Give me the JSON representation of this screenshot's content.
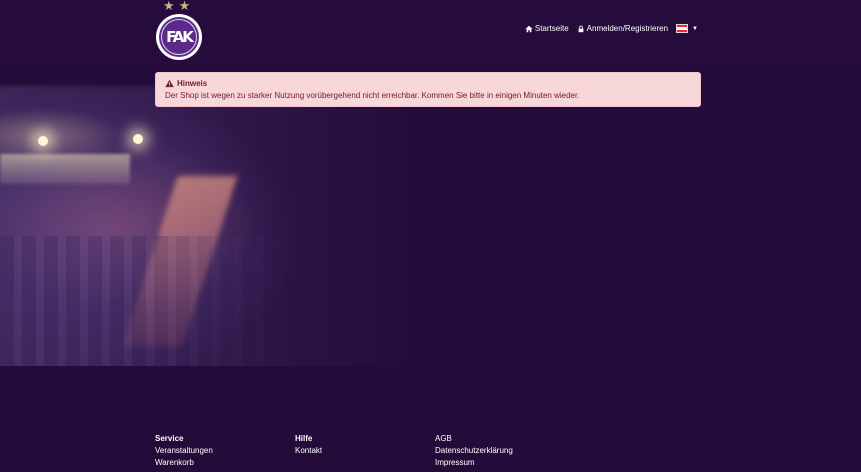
{
  "header": {
    "nav": {
      "home_label": "Startseite",
      "login_label": "Anmelden/Registrieren",
      "language_flag": "austria-flag-icon"
    }
  },
  "alert": {
    "title": "Hinweis",
    "message": "Der Shop ist wegen zu starker Nutzung vorübergehend nicht erreichbar. Kommen Sie bitte in einigen Minuten wieder."
  },
  "footer": {
    "columns": [
      {
        "heading": "Service",
        "links": [
          "Veranstaltungen",
          "Warenkorb"
        ]
      },
      {
        "heading": "Hilfe",
        "links": [
          "Kontakt"
        ]
      },
      {
        "heading": "",
        "links": [
          "AGB",
          "Datenschutzerklärung",
          "Impressum"
        ]
      }
    ]
  },
  "colors": {
    "background": "#240c3a",
    "alert_bg": "#f8d7da",
    "alert_text": "#721c24",
    "star_gold": "#c7b48a"
  }
}
